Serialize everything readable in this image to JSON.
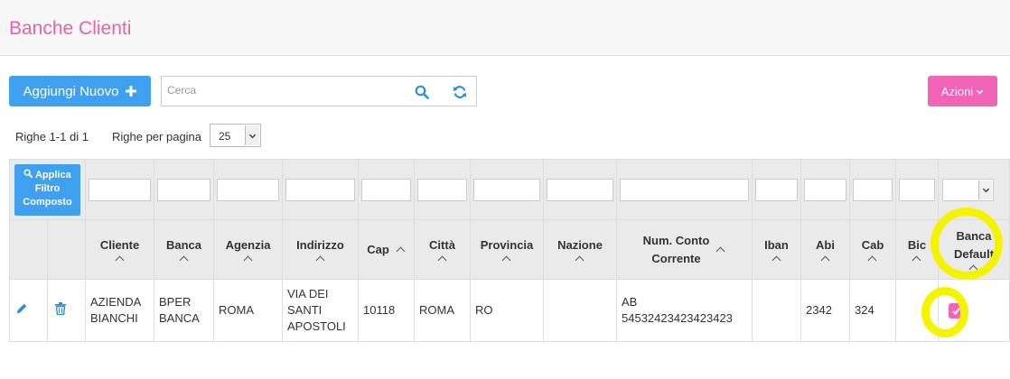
{
  "header": {
    "title": "Banche Clienti"
  },
  "toolbar": {
    "add_label": "Aggiungi Nuovo",
    "search_placeholder": "Cerca",
    "actions_label": "Azioni"
  },
  "pagination": {
    "info": "Righe 1-1 di 1",
    "per_page_label": "Righe per pagina",
    "per_page_value": "25"
  },
  "filter": {
    "apply_label_line1": "Applica",
    "apply_label_line2": "Filtro",
    "apply_label_line3": "Composto"
  },
  "columns": {
    "cliente": "Cliente",
    "banca": "Banca",
    "agenzia": "Agenzia",
    "indirizzo": "Indirizzo",
    "cap": "Cap",
    "citta": "Città",
    "provincia": "Provincia",
    "nazione": "Nazione",
    "num_conto_1": "Num. Conto",
    "num_conto_2": "Corrente",
    "iban": "Iban",
    "abi": "Abi",
    "cab": "Cab",
    "bic": "Bic",
    "banca_default_1": "Banca",
    "banca_default_2": "Default"
  },
  "row": {
    "cliente_1": "AZIENDA",
    "cliente_2": "BIANCHI",
    "banca_1": "BPER",
    "banca_2": "BANCA",
    "agenzia": "ROMA",
    "indirizzo_1": "VIA DEI",
    "indirizzo_2": "SANTI",
    "indirizzo_3": "APOSTOLI",
    "cap": "10118",
    "citta": "ROMA",
    "provincia": "RO",
    "nazione": "",
    "conto_1": "AB",
    "conto_2": "54532423423423423",
    "iban": "",
    "abi": "2342",
    "cab": "324",
    "bic": "",
    "banca_default": true
  },
  "colors": {
    "primary": "#3ea0ef",
    "accent": "#f264b7",
    "title": "#ee5fa7",
    "highlight": "#f4f400"
  },
  "icons": [
    "plus-icon",
    "search-icon",
    "refresh-icon",
    "chevron-down-icon",
    "edit-icon",
    "trash-icon",
    "checkbox-checked-icon"
  ]
}
